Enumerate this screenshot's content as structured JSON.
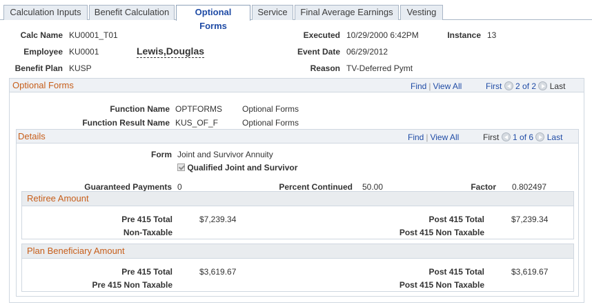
{
  "tabs": [
    {
      "label": "Calculation Inputs"
    },
    {
      "label": "Benefit Calculation"
    },
    {
      "label": "Optional Forms"
    },
    {
      "label": "Service"
    },
    {
      "label": "Final Average Earnings"
    },
    {
      "label": "Vesting"
    }
  ],
  "header": {
    "calc_name_label": "Calc Name",
    "calc_name_value": "KU0001_T01",
    "employee_label": "Employee",
    "employee_value": "KU0001",
    "employee_name": "Lewis,Douglas",
    "benefit_plan_label": "Benefit Plan",
    "benefit_plan_value": "KUSP",
    "executed_label": "Executed",
    "executed_value": "10/29/2000  6:42PM",
    "instance_label": "Instance",
    "instance_value": "13",
    "event_date_label": "Event Date",
    "event_date_value": "06/29/2012",
    "reason_label": "Reason",
    "reason_value": "TV-Deferred Pymt"
  },
  "optional_forms": {
    "title": "Optional Forms",
    "nav": {
      "find": "Find",
      "view_all": "View All",
      "first": "First",
      "count": "2 of 2",
      "last": "Last"
    },
    "function_name_label": "Function Name",
    "function_name_value": "OPTFORMS",
    "function_name_desc": "Optional Forms",
    "function_result_label": "Function Result Name",
    "function_result_value": "KUS_OF_F",
    "function_result_desc": "Optional Forms"
  },
  "details": {
    "title": "Details",
    "nav": {
      "find": "Find",
      "view_all": "View All",
      "first": "First",
      "count": "1 of 6",
      "last": "Last"
    },
    "form_label": "Form",
    "form_value": "Joint and Survivor Annuity",
    "qualified_label": "Qualified Joint and Survivor",
    "qualified_checked": true,
    "guaranteed_label": "Guaranteed Payments",
    "guaranteed_value": "0",
    "percent_label": "Percent Continued",
    "percent_value": "50.00",
    "factor_label": "Factor",
    "factor_value": "0.802497"
  },
  "retiree": {
    "title": "Retiree Amount",
    "pre415_label": "Pre 415 Total",
    "pre415_value": "$7,239.34",
    "nontax_label": "Non-Taxable",
    "post415_label": "Post 415 Total",
    "post415_value": "$7,239.34",
    "post415_nontax_label": "Post 415 Non Taxable"
  },
  "beneficiary": {
    "title": "Plan Beneficiary Amount",
    "pre415_label": "Pre 415 Total",
    "pre415_value": "$3,619.67",
    "pre415_nontax_label": "Pre 415 Non Taxable",
    "post415_label": "Post 415 Total",
    "post415_value": "$3,619.67",
    "post415_nontax_label": "Post 415 Non Taxable"
  }
}
